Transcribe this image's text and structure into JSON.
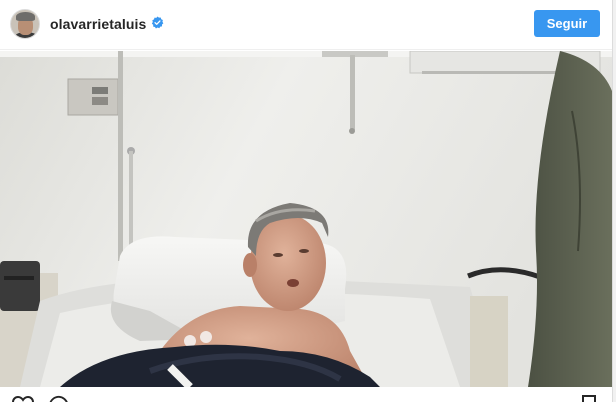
{
  "post": {
    "username": "olavarrietaluis",
    "verified": true,
    "follow_label": "Seguir"
  },
  "icons": {
    "verified": "verified-badge-icon",
    "like": "heart-icon",
    "comment": "comment-icon",
    "save": "bookmark-icon"
  },
  "colors": {
    "accent": "#3897f0",
    "text": "#262626",
    "border": "#efefef"
  }
}
